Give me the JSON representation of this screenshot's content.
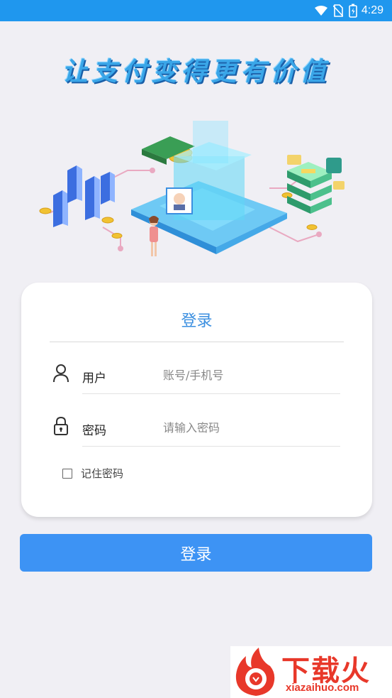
{
  "status_bar": {
    "time": "4:29",
    "icons": [
      "wifi-icon",
      "no-sim-icon",
      "battery-icon"
    ]
  },
  "slogan": "让支付变得更有价值",
  "login_card": {
    "title": "登录",
    "username": {
      "label": "用户",
      "placeholder": "账号/手机号",
      "value": ""
    },
    "password": {
      "label": "密码",
      "placeholder": "请输入密码",
      "value": ""
    },
    "remember": {
      "label": "记住密码",
      "checked": false
    }
  },
  "login_button": "登录",
  "watermark": {
    "text_cn": "下载火",
    "text_en": "xiazaihuo.com"
  },
  "colors": {
    "status_bar": "#1f97ee",
    "accent": "#3d93f4",
    "title": "#3b8fe0",
    "watermark": "#e8382a"
  }
}
